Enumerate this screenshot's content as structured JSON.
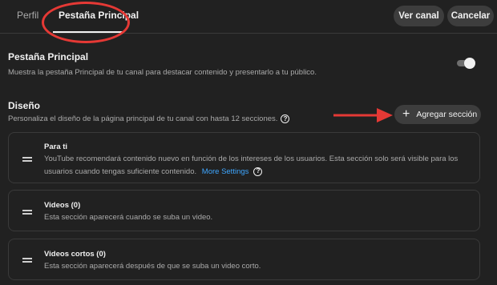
{
  "tabs": [
    {
      "label": "Perfil"
    },
    {
      "label": "Pestaña Principal"
    }
  ],
  "header_buttons": {
    "view_channel": "Ver canal",
    "cancel": "Cancelar"
  },
  "main_tab": {
    "title": "Pestaña Principal",
    "description": "Muestra la pestaña Principal de tu canal para destacar contenido y presentarlo a tu público.",
    "toggle_on": true
  },
  "design": {
    "title": "Diseño",
    "description": "Personaliza el diseño de la página principal de tu canal con hasta 12 secciones.",
    "add_section_label": "Agregar sección"
  },
  "sections": [
    {
      "title": "Para ti",
      "description_line1": "YouTube recomendará contenido nuevo en función de los intereses de los usuarios. Esta sección solo será visible para los",
      "description_line2": "usuarios cuando tengas suficiente contenido.",
      "link": "More Settings"
    },
    {
      "title": "Videos (0)",
      "description": "Esta sección aparecerá cuando se suba un video."
    },
    {
      "title": "Videos cortos (0)",
      "description": "Esta sección aparecerá después de que se suba un video corto."
    }
  ],
  "colors": {
    "background": "#212121",
    "annotation": "#e53935",
    "link": "#3ea6ff"
  }
}
